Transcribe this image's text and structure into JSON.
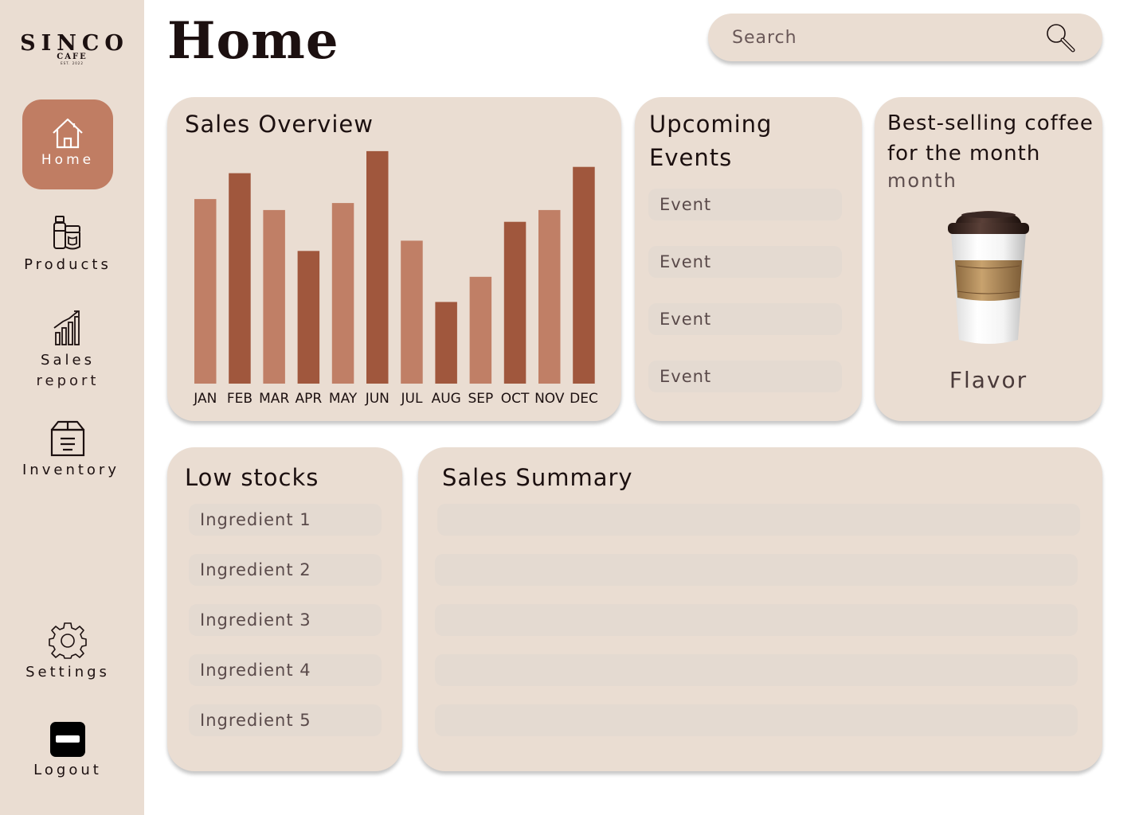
{
  "brand": {
    "name": "SINCO",
    "sub": "CAFE",
    "est": "EST. 2022"
  },
  "page": {
    "title": "Home"
  },
  "search": {
    "placeholder": "Search"
  },
  "sidebar": {
    "items": [
      {
        "label": "Home",
        "icon": "home-icon",
        "active": true
      },
      {
        "label": "Products",
        "icon": "products-icon"
      },
      {
        "label": "Sales",
        "label2": "report",
        "icon": "sales-report-icon"
      },
      {
        "label": "Inventory",
        "icon": "inventory-icon"
      },
      {
        "label": "Settings",
        "icon": "gear-icon"
      },
      {
        "label": "Logout",
        "icon": "logout-icon"
      }
    ]
  },
  "sales_overview": {
    "title": "Sales Overview"
  },
  "chart_data": {
    "type": "bar",
    "title": "Sales Overview",
    "categories": [
      "JAN",
      "FEB",
      "MAR",
      "APR",
      "MAY",
      "JUN",
      "JUL",
      "AUG",
      "SEP",
      "OCT",
      "NOV",
      "DEC"
    ],
    "values": [
      235,
      268,
      221,
      169,
      230,
      296,
      182,
      104,
      136,
      206,
      221,
      276
    ],
    "ylim": [
      0,
      300
    ],
    "grid": false,
    "colors": {
      "light": "#c07f66",
      "dark": "#a0573d"
    }
  },
  "events": {
    "title_line1": "Upcoming",
    "title_line2": "Events",
    "items": [
      "Event",
      "Event",
      "Event",
      "Event"
    ]
  },
  "best_selling": {
    "title_line1": "Best-selling coffee",
    "title_line2": "for the month",
    "month": "month",
    "flavor": "Flavor"
  },
  "low_stocks": {
    "title": "Low stocks",
    "items": [
      "Ingredient 1",
      "Ingredient 2",
      "Ingredient 3",
      "Ingredient 4",
      "Ingredient 5"
    ]
  },
  "sales_summary": {
    "title": "Sales Summary"
  },
  "colors": {
    "panel": "#eaddd2",
    "accent": "#c07d63",
    "row": "#e4dad1",
    "text": "#1c1010"
  }
}
